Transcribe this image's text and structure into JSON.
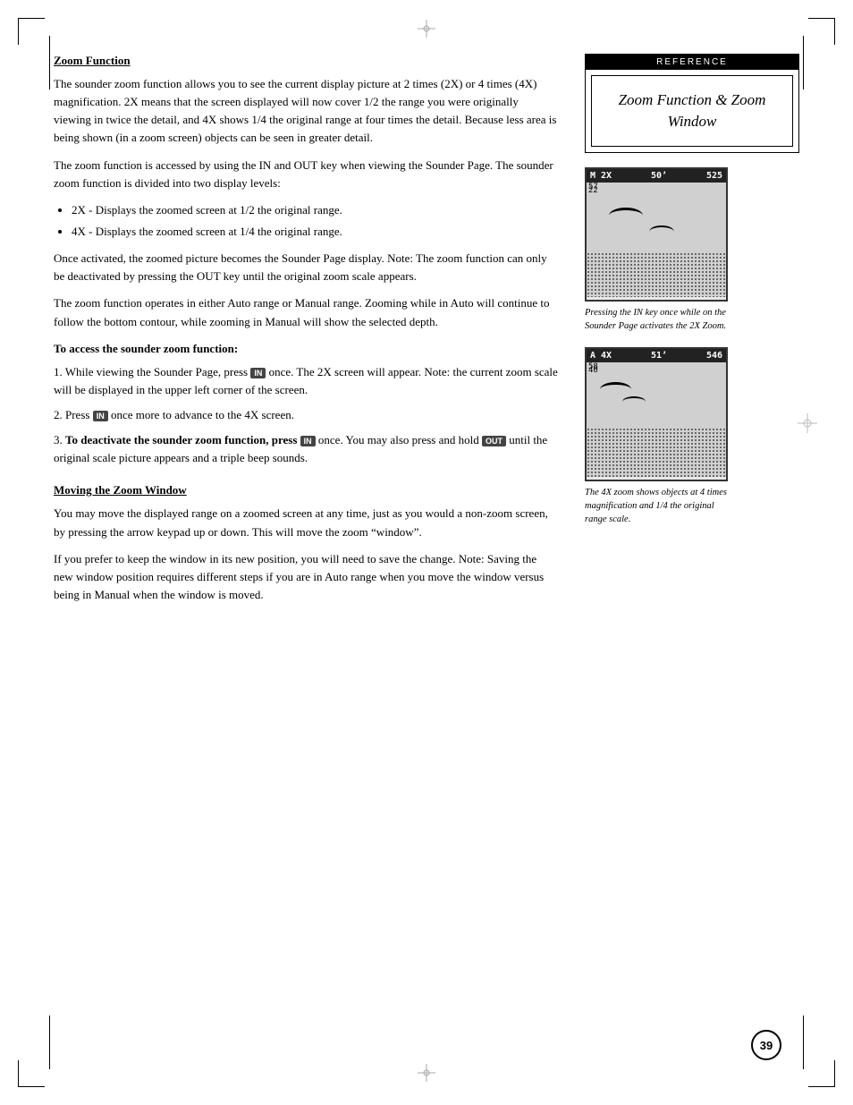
{
  "page": {
    "number": "39",
    "reference_label": "REFERENCE",
    "reference_title": "Zoom Function & Zoom Window"
  },
  "sections": {
    "zoom_function": {
      "heading": "Zoom Function",
      "paragraphs": [
        "The sounder zoom function allows you to see the current display picture at 2 times (2X) or 4 times (4X) magnification. 2X means that the screen displayed will now cover 1/2 the range you were originally viewing in twice the detail, and 4X shows 1/4 the original range at four times the detail. Because less area is being shown (in a zoom screen) objects can be seen in greater detail.",
        "The zoom function is accessed by using the IN and OUT key when viewing the Sounder Page. The sounder zoom function is divided into two display levels:"
      ],
      "bullets": [
        "2X - Displays the zoomed screen at 1/2 the original range.",
        "4X - Displays the zoomed screen at 1/4 the original range."
      ],
      "paragraphs2": [
        "Once activated, the zoomed picture becomes the Sounder Page display. Note: The zoom function can only be deactivated by pressing the OUT key until the original zoom scale appears.",
        "The zoom function operates in either Auto range or Manual range. Zooming while in Auto will continue to follow the bottom contour, while zooming in Manual will show the selected depth."
      ]
    },
    "access_zoom": {
      "sub_heading": "To access the sounder zoom function:",
      "steps": [
        {
          "num": "1.",
          "text_before": "While viewing the Sounder Page, press",
          "key": "IN",
          "text_after": "once. The 2X screen will appear. Note: the current zoom scale will be displayed in the upper left corner of the screen."
        },
        {
          "num": "2.",
          "text_before": "Press",
          "key": "IN",
          "text_after": "once more to advance to the 4X screen."
        },
        {
          "num": "3.",
          "text_before": "To deactivate the sounder zoom function, press",
          "key": "IN",
          "text_middle": "once. You may also press and hold",
          "key2": "OUT",
          "text_after": "until the original scale picture appears and a triple beep sounds."
        }
      ]
    },
    "moving_zoom": {
      "heading": "Moving the Zoom Window",
      "paragraphs": [
        "You may move the displayed range on a zoomed screen at any time, just as you would a non-zoom screen, by pressing the arrow keypad up or down. This will move the zoom “window”.",
        "If you prefer to keep the window in its new position, you will need to save the change. Note: Saving the new window position requires different steps if you are in Auto range when you move the window versus being in Manual when the window is moved."
      ]
    }
  },
  "screens": {
    "screen1": {
      "header_left": "M 2X",
      "header_mid": "50’",
      "header_right": "525",
      "scale_top": "22",
      "scale_bottom": "57",
      "caption": "Pressing the IN key once while on the Sounder Page activates the 2X Zoom."
    },
    "screen2": {
      "header_left": "A 4X",
      "header_mid": "51’",
      "header_right": "546",
      "scale_top": "40",
      "scale_bottom": "58",
      "caption": "The 4X zoom shows objects at 4 times magnification and 1/4 the original range scale."
    }
  }
}
